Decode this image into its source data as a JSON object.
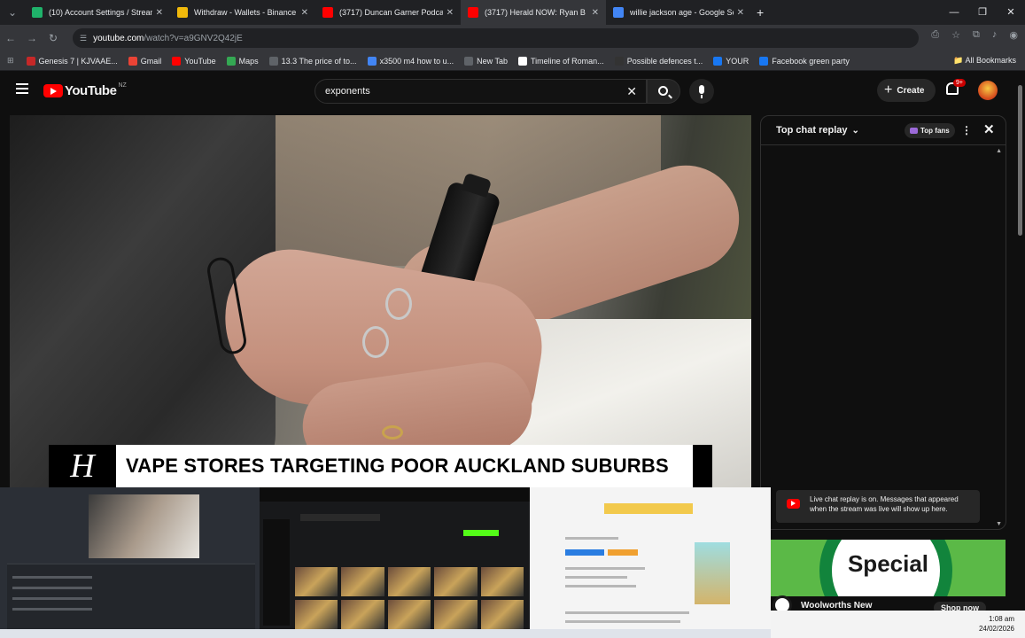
{
  "browser": {
    "tabs": [
      {
        "title": "(10) Account Settings / Streaml",
        "fav_color": "#1fb26a",
        "active": false
      },
      {
        "title": "Withdraw - Wallets - Binance",
        "fav_color": "#f0b90b",
        "active": false
      },
      {
        "title": "(3717) Duncan Garner Podcast",
        "fav_color": "#ff0000",
        "active": false
      },
      {
        "title": "(3717) Herald NOW: Ryan B",
        "fav_color": "#ff0000",
        "active": true
      },
      {
        "title": "willie jackson age - Google Sea",
        "fav_color": "#4285f4",
        "active": false
      }
    ],
    "new_tab": "+",
    "url_host": "youtube.com",
    "url_path": "/watch?v=a9GNV2Q42jE",
    "bookmarks": [
      {
        "label": "Genesis 7 | KJVAAE...",
        "color": "#c62828"
      },
      {
        "label": "Gmail",
        "color": "#ea4335"
      },
      {
        "label": "YouTube",
        "color": "#ff0000"
      },
      {
        "label": "Maps",
        "color": "#34a853"
      },
      {
        "label": "13.3 The price of to...",
        "color": "#5f6368"
      },
      {
        "label": "x3500 m4 how to u...",
        "color": "#4285f4"
      },
      {
        "label": "New Tab",
        "color": "#5f6368"
      },
      {
        "label": "Timeline of Roman...",
        "color": "#ffffff"
      },
      {
        "label": "Possible defences t...",
        "color": "#333333"
      },
      {
        "label": "YOUR",
        "color": "#1877f2"
      },
      {
        "label": "Facebook green party",
        "color": "#1877f2"
      }
    ],
    "all_bookmarks": "All Bookmarks"
  },
  "youtube": {
    "logo_text": "YouTube",
    "region": "NZ",
    "search_value": "exponents",
    "create_label": "Create",
    "notif_count": "9+"
  },
  "video": {
    "lower_third_logo": "H",
    "headline": "VAPE STORES TARGETING POOR AUCKLAND SUBURBS"
  },
  "chat": {
    "title": "Top chat replay",
    "top_fans": "Top fans",
    "notice": "Live chat replay is on. Messages that appeared when the stream was live will show up here."
  },
  "ad": {
    "headline": "Special",
    "advertiser": "Woolworths New",
    "cta": "Shop now"
  },
  "system": {
    "time": "1:08 am",
    "date": "24/02/2026"
  }
}
